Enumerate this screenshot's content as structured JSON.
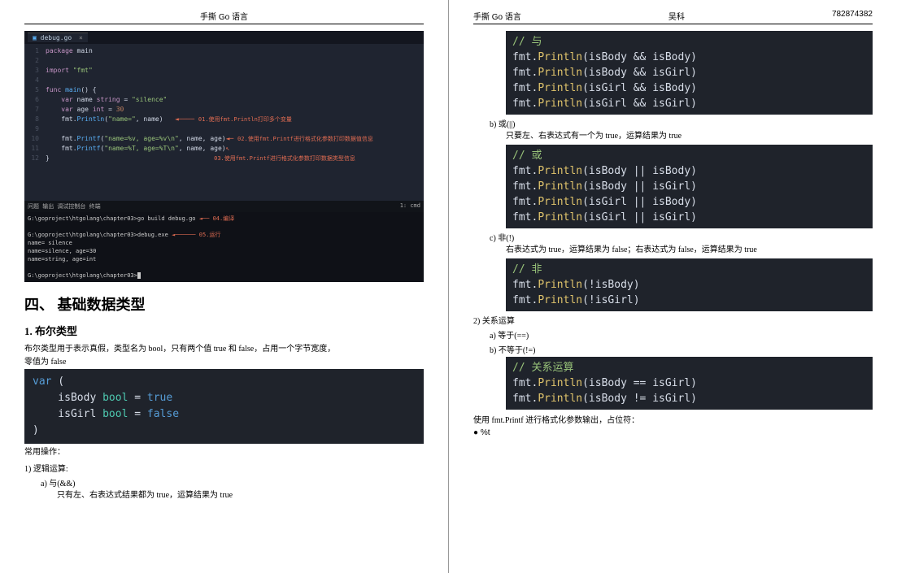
{
  "header": {
    "title": "手撕 Go 语言",
    "author": "吴科",
    "id": "782874382"
  },
  "ide": {
    "tab": "debug.go",
    "lines": [
      {
        "n": "1",
        "code": "package main",
        "cls": ""
      },
      {
        "n": "2",
        "code": "",
        "cls": ""
      },
      {
        "n": "3",
        "code": "import \"fmt\"",
        "cls": ""
      },
      {
        "n": "4",
        "code": "",
        "cls": ""
      },
      {
        "n": "5",
        "code": "func main() {",
        "cls": ""
      },
      {
        "n": "6",
        "code": "    var name string = \"silence\"",
        "cls": ""
      },
      {
        "n": "7",
        "code": "    var age int = 30",
        "cls": ""
      },
      {
        "n": "8",
        "code": "    fmt.Println(\"name=\", name)",
        "ann": "01.使用fmt.Println打印多个变量"
      },
      {
        "n": "9",
        "code": "",
        "cls": ""
      },
      {
        "n": "10",
        "code": "    fmt.Printf(\"name=%v, age=%v\\n\", name, age)",
        "ann": "02.使用fmt.Printf进行格式化参数打印数据值信息"
      },
      {
        "n": "11",
        "code": "    fmt.Printf(\"name=%T, age=%T\\n\", name, age)",
        "cls": ""
      },
      {
        "n": "12",
        "code": "}",
        "ann": "03.使用fmt.Printf进行格式化参数打印数据类型信息"
      }
    ],
    "termTabs": "问题    输出    调试控制台    终端",
    "termRight": "1: cmd",
    "termLines": [
      "G:\\goproject\\htgolang\\chapter03>go build debug.go",
      "",
      "G:\\goproject\\htgolang\\chapter03>debug.exe",
      "name= silence",
      "name=silence, age=30",
      "name=string, age=int",
      "",
      "G:\\goproject\\htgolang\\chapter03>"
    ],
    "termAnn1": "04.编译",
    "termAnn2": "05.运行"
  },
  "section": {
    "heading": "四、  基础数据类型",
    "sub1": "1. 布尔类型",
    "boolDesc1": "布尔类型用于表示真假，类型名为 bool，只有两个值 true 和 false，占用一个字节宽度，",
    "boolDesc2": "零值为 false",
    "varBlock": "var (\n    isBody bool = true\n    isGirl bool = false\n)",
    "commonOps": "常用操作：",
    "logic": "1)   逻辑运算:",
    "andLabel": "a)   与(&&)",
    "andDesc": "只有左、右表达式结果都为 true，运算结果为 true"
  },
  "right": {
    "andBlock": "// 与\nfmt.Println(isBody && isBody)\nfmt.Println(isBody && isGirl)\nfmt.Println(isGirl && isBody)\nfmt.Println(isGirl && isGirl)",
    "orLabel": "b)   或(||)",
    "orDesc": "只要左、右表达式有一个为 true，运算结果为 true",
    "orBlock": "// 或\nfmt.Println(isBody || isBody)\nfmt.Println(isBody || isGirl)\nfmt.Println(isGirl || isBody)\nfmt.Println(isGirl || isGirl)",
    "notLabel": "c)   非(!)",
    "notDesc": "右表达式为 true，运算结果为 false；右表达式为 false，运算结果为 true",
    "notBlock": "// 非\nfmt.Println(!isBody)\nfmt.Println(!isGirl)",
    "relLabel": "2)   关系运算",
    "eqLabel": "a)   等于(==)",
    "neqLabel": "b)   不等于(!=)",
    "relBlock": "// 关系运算\nfmt.Println(isBody == isGirl)\nfmt.Println(isBody != isGirl)",
    "printf": "使用 fmt.Printf 进行格式化参数输出，占位符：",
    "placeholder": "●    %t"
  }
}
